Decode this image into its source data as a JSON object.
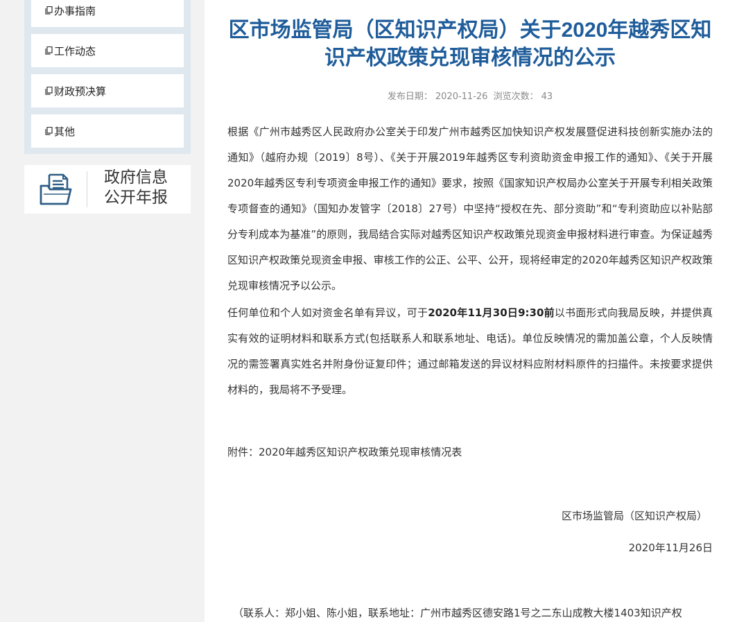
{
  "sidebar": {
    "menu": [
      {
        "label": "办事指南",
        "icon": "document-icon"
      },
      {
        "label": "工作动态",
        "icon": "document-icon"
      },
      {
        "label": "财政预决算",
        "icon": "document-icon"
      },
      {
        "label": "其他",
        "icon": "document-icon"
      }
    ],
    "annual_report": {
      "line1": "政府信息",
      "line2": "公开年报",
      "icon": "folder-document-icon"
    }
  },
  "article": {
    "title": "区市场监管局（区知识产权局）关于2020年越秀区知识产权政策兑现审核情况的公示",
    "publish_label": "发布日期：",
    "publish_date": "2020-11-26",
    "views_label": "浏览次数：",
    "views": "43",
    "para1": "根据《广州市越秀区人民政府办公室关于印发广州市越秀区加快知识产权发展暨促进科技创新实施办法的通知》（越府办规〔2019〕8号）、《关于开展2019年越秀区专利资助资金申报工作的通知》、《关于开展2020年越秀区专利专项资金申报工作的通知》要求，按照《国家知识产权局办公室关于开展专利相关政策专项督查的通知》（国知办发管字〔2018〕27号）中坚持“授权在先、部分资助”和“专利资助应以补贴部分专利成本为基准”的原则，我局结合实际对越秀区知识产权政策兑现资金申报材料进行审查。为保证越秀区知识产权政策兑现资金申报、审核工作的公正、公平、公开，现将经审定的2020年越秀区知识产权政策兑现审核情况予以公示。",
    "para2_before": "任何单位和个人如对资金名单有异议，可于",
    "para2_deadline": "2020年11月30日9:30前",
    "para2_after": "以书面形式向我局反映，并提供真实有效的证明材料和联系方式(包括联系人和联系地址、电话)。单位反映情况的需加盖公章，个人反映情况的需签署真实姓名并附身份证复印件；通过邮箱发送的异议材料应附材料原件的扫描件。未按要求提供材料的，我局将不予受理。",
    "attachment_label": "附件：",
    "attachment_name": "2020年越秀区知识产权政策兑现审核情况表",
    "sign_org": "区市场监管局（区知识产权局）",
    "sign_date": "2020年11月26日",
    "contact": "（联系人：郑小姐、陈小姐，联系地址：广州市越秀区德安路1号之二东山成教大楼1403知识产权"
  },
  "colors": {
    "title": "#1e5c9a",
    "sidebar_bg": "#f2f2f2",
    "menu_frame": "#dfe8ef",
    "icon_blue": "#2f5d86"
  }
}
